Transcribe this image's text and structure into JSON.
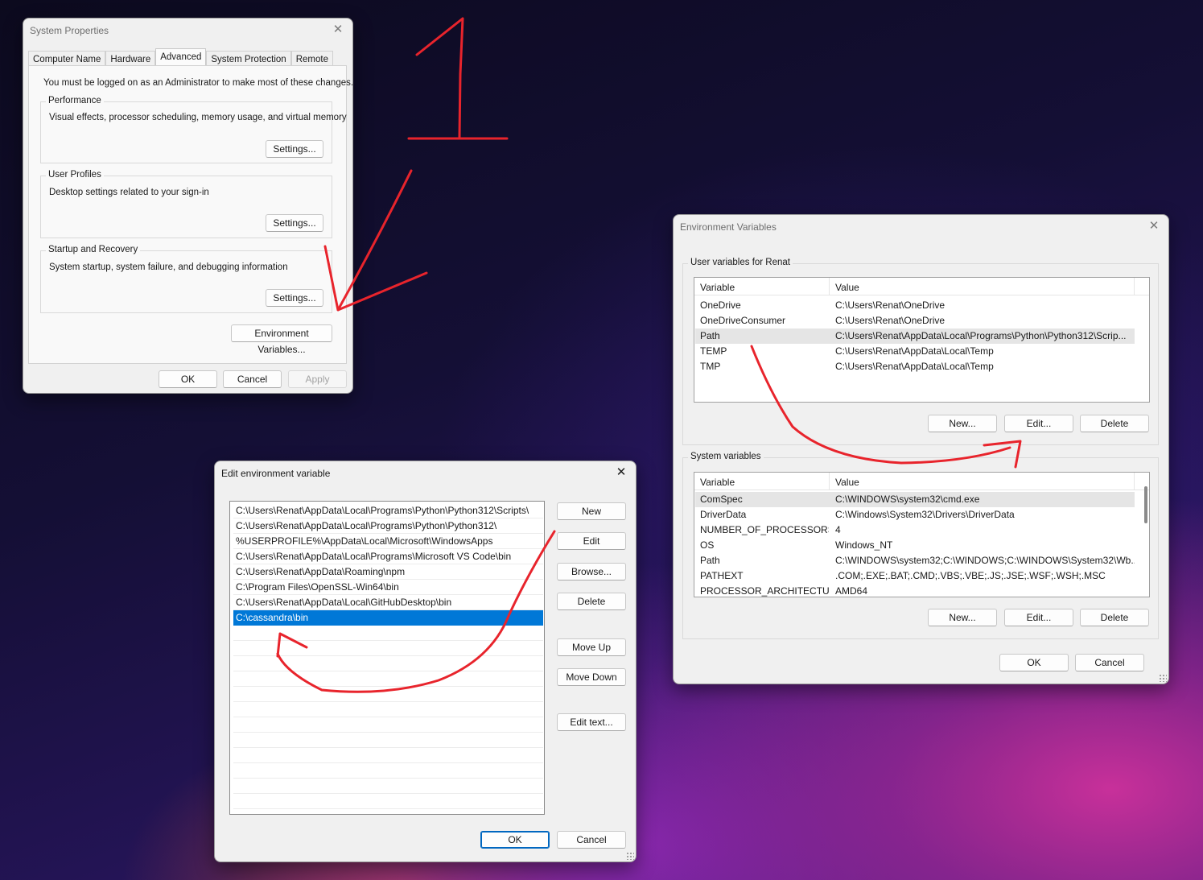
{
  "system_properties": {
    "title": "System Properties",
    "tabs": [
      "Computer Name",
      "Hardware",
      "Advanced",
      "System Protection",
      "Remote"
    ],
    "active_tab": "Advanced",
    "admin_note": "You must be logged on as an Administrator to make most of these changes.",
    "performance": {
      "title": "Performance",
      "description": "Visual effects, processor scheduling, memory usage, and virtual memory",
      "button": "Settings..."
    },
    "user_profiles": {
      "title": "User Profiles",
      "description": "Desktop settings related to your sign-in",
      "button": "Settings..."
    },
    "startup_recovery": {
      "title": "Startup and Recovery",
      "description": "System startup, system failure, and debugging information",
      "button": "Settings..."
    },
    "env_button": "Environment Variables...",
    "ok": "OK",
    "cancel": "Cancel",
    "apply": "Apply"
  },
  "environment_variables": {
    "title": "Environment Variables",
    "user_group_title": "User variables for Renat",
    "col_variable": "Variable",
    "col_value": "Value",
    "user_vars": [
      {
        "name": "OneDrive",
        "value": "C:\\Users\\Renat\\OneDrive"
      },
      {
        "name": "OneDriveConsumer",
        "value": "C:\\Users\\Renat\\OneDrive"
      },
      {
        "name": "Path",
        "value": "C:\\Users\\Renat\\AppData\\Local\\Programs\\Python\\Python312\\Scrip..."
      },
      {
        "name": "TEMP",
        "value": "C:\\Users\\Renat\\AppData\\Local\\Temp"
      },
      {
        "name": "TMP",
        "value": "C:\\Users\\Renat\\AppData\\Local\\Temp"
      }
    ],
    "user_buttons": {
      "new": "New...",
      "edit": "Edit...",
      "delete": "Delete"
    },
    "system_group_title": "System variables",
    "system_vars": [
      {
        "name": "ComSpec",
        "value": "C:\\WINDOWS\\system32\\cmd.exe"
      },
      {
        "name": "DriverData",
        "value": "C:\\Windows\\System32\\Drivers\\DriverData"
      },
      {
        "name": "NUMBER_OF_PROCESSORS",
        "value": "4"
      },
      {
        "name": "OS",
        "value": "Windows_NT"
      },
      {
        "name": "Path",
        "value": "C:\\WINDOWS\\system32;C:\\WINDOWS;C:\\WINDOWS\\System32\\Wb..."
      },
      {
        "name": "PATHEXT",
        "value": ".COM;.EXE;.BAT;.CMD;.VBS;.VBE;.JS;.JSE;.WSF;.WSH;.MSC"
      },
      {
        "name": "PROCESSOR_ARCHITECTURE",
        "value": "AMD64"
      }
    ],
    "system_buttons": {
      "new": "New...",
      "edit": "Edit...",
      "delete": "Delete"
    },
    "ok": "OK",
    "cancel": "Cancel"
  },
  "edit_env": {
    "title": "Edit environment variable",
    "paths": [
      "C:\\Users\\Renat\\AppData\\Local\\Programs\\Python\\Python312\\Scripts\\",
      "C:\\Users\\Renat\\AppData\\Local\\Programs\\Python\\Python312\\",
      "%USERPROFILE%\\AppData\\Local\\Microsoft\\WindowsApps",
      "C:\\Users\\Renat\\AppData\\Local\\Programs\\Microsoft VS Code\\bin",
      "C:\\Users\\Renat\\AppData\\Roaming\\npm",
      "C:\\Program Files\\OpenSSL-Win64\\bin",
      "C:\\Users\\Renat\\AppData\\Local\\GitHubDesktop\\bin",
      "C:\\cassandra\\bin"
    ],
    "selected_index": 7,
    "buttons": {
      "new": "New",
      "edit": "Edit",
      "browse": "Browse...",
      "delete": "Delete",
      "move_up": "Move Up",
      "move_down": "Move Down",
      "edit_text": "Edit text..."
    },
    "ok": "OK",
    "cancel": "Cancel"
  },
  "annotations": {
    "color": "#e8242c",
    "number_label": "1"
  }
}
